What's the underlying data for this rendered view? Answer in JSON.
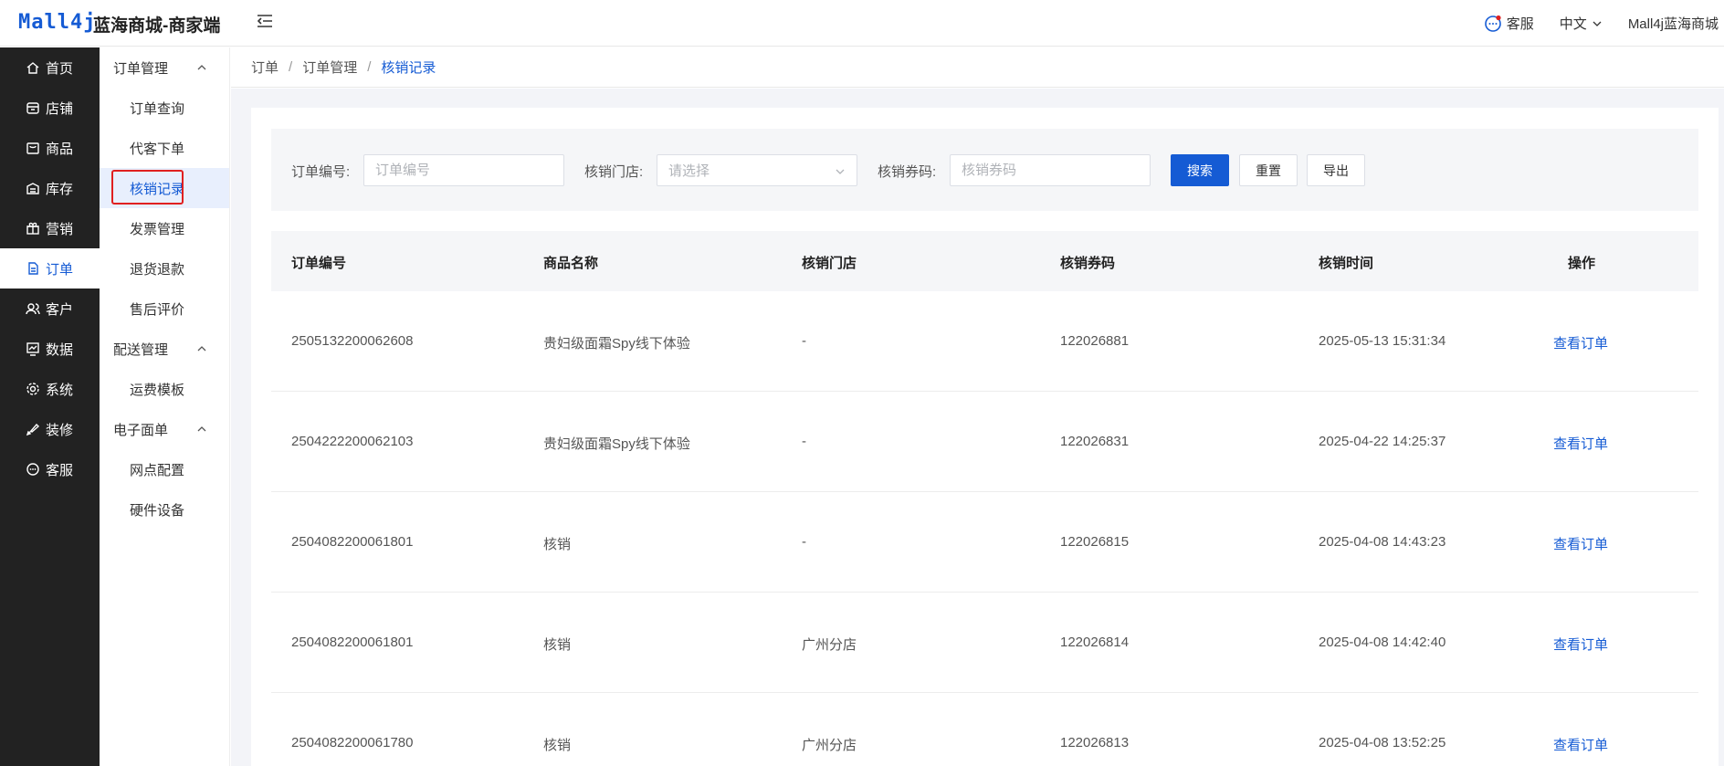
{
  "header": {
    "logo": "Mall4j",
    "shop_title": "蓝海商城-商家端",
    "service_label": "客服",
    "language_label": "中文",
    "store_name": "Mall4j蓝海商城"
  },
  "nav": {
    "items": [
      {
        "label": "首页",
        "icon": "home-icon"
      },
      {
        "label": "店铺",
        "icon": "store-icon"
      },
      {
        "label": "商品",
        "icon": "bag-icon"
      },
      {
        "label": "库存",
        "icon": "warehouse-icon"
      },
      {
        "label": "营销",
        "icon": "gift-icon"
      },
      {
        "label": "订单",
        "icon": "document-icon"
      },
      {
        "label": "客户",
        "icon": "users-icon"
      },
      {
        "label": "数据",
        "icon": "chart-icon"
      },
      {
        "label": "系统",
        "icon": "gear-icon"
      },
      {
        "label": "装修",
        "icon": "brush-icon"
      },
      {
        "label": "客服",
        "icon": "chat-icon"
      }
    ],
    "active_index": 5
  },
  "subnav": {
    "group_order": "订单管理",
    "order_items": [
      "订单查询",
      "代客下单",
      "核销记录",
      "发票管理",
      "退货退款",
      "售后评价"
    ],
    "group_delivery": "配送管理",
    "delivery_items": [
      "运费模板"
    ],
    "group_waybill": "电子面单",
    "waybill_items": [
      "网点配置",
      "硬件设备"
    ]
  },
  "breadcrumb": [
    "订单",
    "订单管理",
    "核销记录"
  ],
  "search": {
    "order_no_label": "订单编号:",
    "order_no_placeholder": "订单编号",
    "store_label": "核销门店:",
    "store_placeholder": "请选择",
    "coupon_label": "核销券码:",
    "coupon_placeholder": "核销券码",
    "search_button": "搜索",
    "reset_button": "重置",
    "export_button": "导出"
  },
  "table": {
    "columns": [
      "订单编号",
      "商品名称",
      "核销门店",
      "核销券码",
      "核销时间",
      "操作"
    ],
    "rows": [
      {
        "order_no": "2505132200062608",
        "product": "贵妇级面霜Spy线下体验",
        "store": "-",
        "code": "122026881",
        "time": "2025-05-13 15:31:34",
        "action": "查看订单"
      },
      {
        "order_no": "2504222200062103",
        "product": "贵妇级面霜Spy线下体验",
        "store": "-",
        "code": "122026831",
        "time": "2025-04-22 14:25:37",
        "action": "查看订单"
      },
      {
        "order_no": "2504082200061801",
        "product": "核销",
        "store": "-",
        "code": "122026815",
        "time": "2025-04-08 14:43:23",
        "action": "查看订单"
      },
      {
        "order_no": "2504082200061801",
        "product": "核销",
        "store": "广州分店",
        "code": "122026814",
        "time": "2025-04-08 14:42:40",
        "action": "查看订单"
      },
      {
        "order_no": "2504082200061780",
        "product": "核销",
        "store": "广州分店",
        "code": "122026813",
        "time": "2025-04-08 13:52:25",
        "action": "查看订单"
      }
    ]
  },
  "colors": {
    "primary": "#155bd4",
    "nav_bg": "#222222",
    "highlight": "#e02020"
  }
}
